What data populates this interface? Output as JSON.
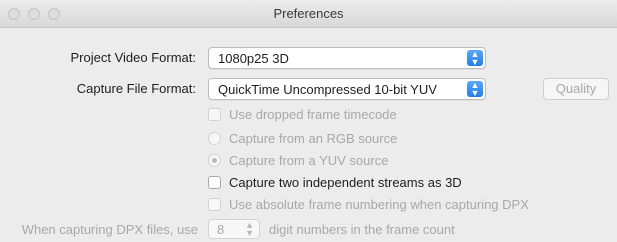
{
  "window": {
    "title": "Preferences"
  },
  "colors": {
    "accent": "#1f7cf2",
    "disabled_text": "#a8a8a8"
  },
  "project_video_format": {
    "label": "Project Video Format:",
    "value": "1080p25 3D"
  },
  "capture_file_format": {
    "label": "Capture File Format:",
    "value": "QuickTime Uncompressed 10-bit YUV"
  },
  "quality_button": {
    "label": "Quality"
  },
  "options": {
    "dropped_frame_timecode": "Use dropped frame timecode",
    "rgb_source": "Capture from an RGB source",
    "yuv_source": "Capture from a YUV source",
    "two_streams_3d": "Capture two independent streams as 3D",
    "absolute_frame_numbering": "Use absolute frame numbering when capturing DPX"
  },
  "dpx_digits": {
    "label_prefix": "When capturing DPX files, use",
    "value": "8",
    "label_suffix": "digit numbers in the frame count"
  }
}
